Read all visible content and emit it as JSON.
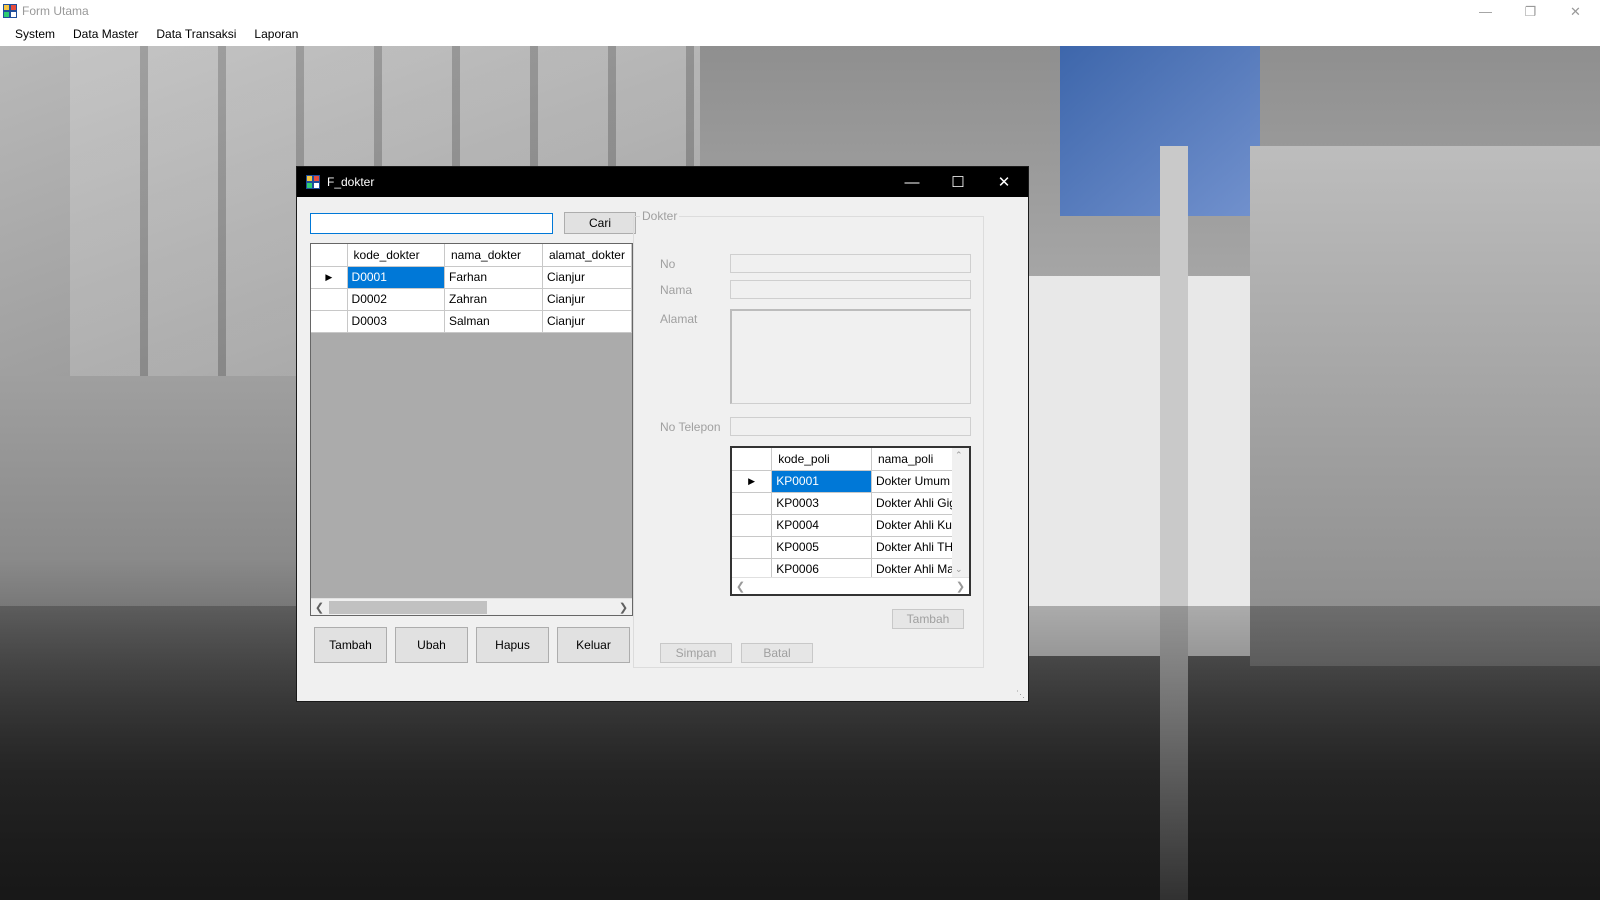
{
  "main_window": {
    "title": "Form Utama",
    "controls": {
      "minimize": "—",
      "restore": "❐",
      "close": "✕"
    }
  },
  "menu": [
    "System",
    "Data Master",
    "Data Transaksi",
    "Laporan"
  ],
  "dialog": {
    "title": "F_dokter",
    "controls": {
      "minimize": "—",
      "maximize": "☐",
      "close": "✕"
    },
    "search": {
      "value": "",
      "button": "Cari"
    },
    "doctors_grid": {
      "columns": [
        "kode_dokter",
        "nama_dokter",
        "alamat_dokter"
      ],
      "rows": [
        [
          "D0001",
          "Farhan",
          "Cianjur"
        ],
        [
          "D0002",
          "Zahran",
          "Cianjur"
        ],
        [
          "D0003",
          "Salman",
          "Cianjur"
        ]
      ],
      "current_row_marker": "▶"
    },
    "buttons": {
      "tambah": "Tambah",
      "ubah": "Ubah",
      "hapus": "Hapus",
      "keluar": "Keluar"
    },
    "group": {
      "title": "Dokter",
      "labels": {
        "no": "No",
        "nama": "Nama",
        "alamat": "Alamat",
        "telepon": "No Telepon"
      },
      "poli_grid": {
        "columns": [
          "kode_poli",
          "nama_poli"
        ],
        "rows": [
          [
            "KP0001",
            "Dokter Umum"
          ],
          [
            "KP0003",
            "Dokter Ahli Gigi"
          ],
          [
            "KP0004",
            "Dokter Ahli Kulit"
          ],
          [
            "KP0005",
            "Dokter Ahli THT"
          ],
          [
            "KP0006",
            "Dokter Ahli Mata"
          ]
        ]
      },
      "tambah_button": "Tambah",
      "simpan_button": "Simpan",
      "batal_button": "Batal"
    }
  }
}
